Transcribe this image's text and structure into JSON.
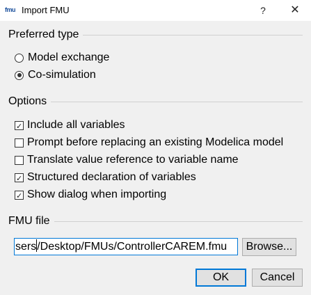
{
  "window": {
    "icon_text": "fmu",
    "title": "Import FMU",
    "help_label": "?",
    "close_label": "✕"
  },
  "preferred_type": {
    "title": "Preferred type",
    "options": [
      {
        "label": "Model exchange",
        "selected": false
      },
      {
        "label": "Co-simulation",
        "selected": true
      }
    ]
  },
  "options_group": {
    "title": "Options",
    "items": [
      {
        "label": "Include all variables",
        "checked": true
      },
      {
        "label": "Prompt before replacing an existing Modelica model",
        "checked": false
      },
      {
        "label": "Translate value reference to variable name",
        "checked": false
      },
      {
        "label": "Structured declaration of variables",
        "checked": true
      },
      {
        "label": "Show dialog when importing",
        "checked": true
      }
    ]
  },
  "fmu_file": {
    "title": "FMU file",
    "value_before_caret": "sers",
    "value_after_caret": "/Desktop/FMUs/ControllerCAREM.fmu",
    "browse_label": "Browse..."
  },
  "buttons": {
    "ok_label": "OK",
    "cancel_label": "Cancel"
  }
}
